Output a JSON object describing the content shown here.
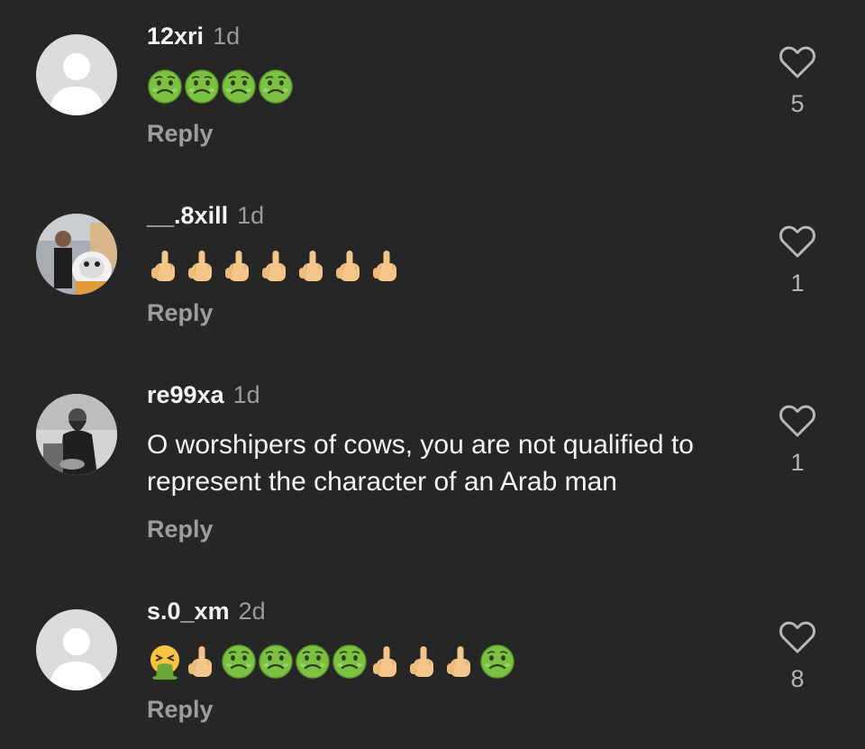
{
  "comments": [
    {
      "username": "12xri",
      "time": "1d",
      "text": "",
      "emojis": [
        "nauseated-face",
        "nauseated-face",
        "nauseated-face",
        "nauseated-face"
      ],
      "reply_label": "Reply",
      "likes": "5",
      "avatar": "default-avatar"
    },
    {
      "username": "__.8xill",
      "time": "1d",
      "text": "",
      "emojis": [
        "middle-finger",
        "middle-finger",
        "middle-finger",
        "middle-finger",
        "middle-finger",
        "middle-finger",
        "middle-finger"
      ],
      "reply_label": "Reply",
      "likes": "1",
      "avatar": "photo-avatar"
    },
    {
      "username": "re99xa",
      "time": "1d",
      "text": "O worshipers of cows, you are not qualified to represent the character of an Arab man",
      "emojis": [],
      "reply_label": "Reply",
      "likes": "1",
      "avatar": "photo-avatar"
    },
    {
      "username": "s.0_xm",
      "time": "2d",
      "text": "",
      "emojis": [
        "vomiting-face",
        "middle-finger",
        "nauseated-face",
        "nauseated-face",
        "nauseated-face",
        "nauseated-face",
        "middle-finger",
        "middle-finger",
        "middle-finger",
        "nauseated-face"
      ],
      "reply_label": "Reply",
      "likes": "8",
      "avatar": "default-avatar"
    }
  ],
  "colors": {
    "background": "#262626",
    "username": "#f4f4f4",
    "secondary_text": "#9b9b9b",
    "nauseated_green": "#7cc142",
    "finger_skin": "#f4c689"
  }
}
